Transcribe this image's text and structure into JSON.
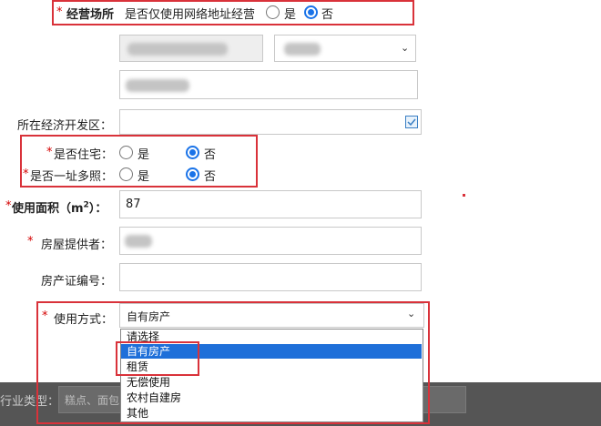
{
  "business_place": {
    "required_mark": "*",
    "label": "经营场所",
    "question": "是否仅使用网络地址经营",
    "options": [
      "是",
      "否"
    ],
    "selected": "否"
  },
  "dev_zone": {
    "label": "所在经济开发区：",
    "value": ""
  },
  "residential": {
    "required_mark": "*",
    "label": "是否住宅：",
    "options": [
      "是",
      "否"
    ],
    "selected": "否"
  },
  "multi_license": {
    "required_mark": "*",
    "label": "是否一址多照：",
    "options": [
      "是",
      "否"
    ],
    "selected": "否"
  },
  "area": {
    "required_mark": "*",
    "label_prefix": "使用面积（m",
    "label_sup": "2",
    "label_suffix": "）：",
    "value": "87"
  },
  "provider": {
    "required_mark": "*",
    "label": "房屋提供者："
  },
  "certificate": {
    "label": "房产证编号：",
    "value": ""
  },
  "usage": {
    "required_mark": "*",
    "label": "使用方式：",
    "value": "自有房产",
    "dropdown_options": [
      "请选择",
      "自有房产",
      "租赁",
      "无偿使用",
      "农村自建房",
      "其他"
    ],
    "highlighted_option": "自有房产"
  },
  "industry": {
    "label": "行业类型：",
    "value": "糕点、面包"
  },
  "colors": {
    "highlight_box": "#d9323a",
    "selection": "#1e6fd9",
    "required": "#d40000"
  }
}
